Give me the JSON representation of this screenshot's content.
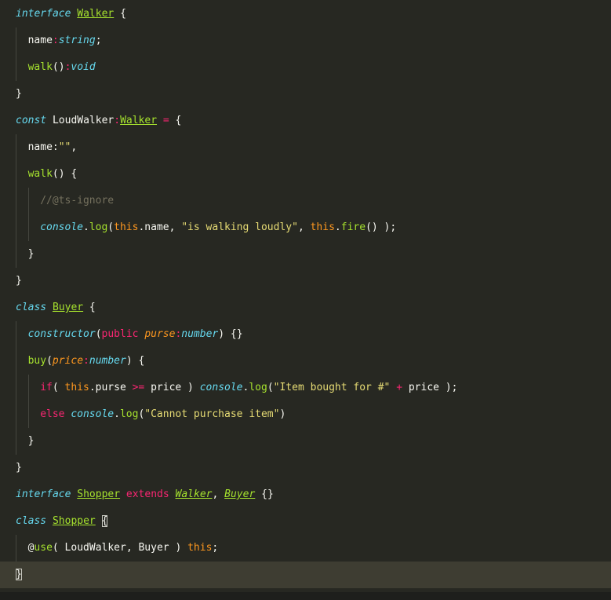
{
  "editor": {
    "language": "typescript",
    "theme": {
      "background": "#272822",
      "current_line": "#3e3d32"
    },
    "lines": [
      {
        "indent": 0,
        "tokens": [
          {
            "t": "interface",
            "c": "kw"
          },
          {
            "t": " ",
            "c": "pl"
          },
          {
            "t": "Walker",
            "c": "ty"
          },
          {
            "t": " {",
            "c": "pl"
          }
        ]
      },
      {
        "indent": 1,
        "tokens": [
          {
            "t": "name",
            "c": "pl"
          },
          {
            "t": ":",
            "c": "op"
          },
          {
            "t": "string",
            "c": "tp"
          },
          {
            "t": ";",
            "c": "pl"
          }
        ]
      },
      {
        "indent": 1,
        "tokens": [
          {
            "t": "walk",
            "c": "fn"
          },
          {
            "t": "()",
            "c": "pl"
          },
          {
            "t": ":",
            "c": "op"
          },
          {
            "t": "void",
            "c": "tp"
          }
        ]
      },
      {
        "indent": 0,
        "tokens": [
          {
            "t": "}",
            "c": "pl"
          }
        ]
      },
      {
        "indent": 0,
        "tokens": [
          {
            "t": "const",
            "c": "kw"
          },
          {
            "t": " LoudWalker",
            "c": "pl"
          },
          {
            "t": ":",
            "c": "op"
          },
          {
            "t": "Walker",
            "c": "ty"
          },
          {
            "t": " ",
            "c": "pl"
          },
          {
            "t": "=",
            "c": "op"
          },
          {
            "t": " {",
            "c": "pl"
          }
        ]
      },
      {
        "indent": 1,
        "tokens": [
          {
            "t": "name:",
            "c": "pl"
          },
          {
            "t": "\"\"",
            "c": "str"
          },
          {
            "t": ",",
            "c": "pl"
          }
        ]
      },
      {
        "indent": 1,
        "tokens": [
          {
            "t": "walk",
            "c": "fn"
          },
          {
            "t": "() {",
            "c": "pl"
          }
        ]
      },
      {
        "indent": 2,
        "tokens": [
          {
            "t": "//@ts-ignore",
            "c": "cm"
          }
        ]
      },
      {
        "indent": 2,
        "tokens": [
          {
            "t": "console",
            "c": "cn"
          },
          {
            "t": ".",
            "c": "pl"
          },
          {
            "t": "log",
            "c": "fn"
          },
          {
            "t": "(",
            "c": "pl"
          },
          {
            "t": "this",
            "c": "th"
          },
          {
            "t": ".name, ",
            "c": "pl"
          },
          {
            "t": "\"is walking loudly\"",
            "c": "str"
          },
          {
            "t": ", ",
            "c": "pl"
          },
          {
            "t": "this",
            "c": "th"
          },
          {
            "t": ".",
            "c": "pl"
          },
          {
            "t": "fire",
            "c": "fn"
          },
          {
            "t": "() );",
            "c": "pl"
          }
        ]
      },
      {
        "indent": 1,
        "tokens": [
          {
            "t": "}",
            "c": "pl"
          }
        ]
      },
      {
        "indent": 0,
        "tokens": [
          {
            "t": "}",
            "c": "pl"
          }
        ]
      },
      {
        "indent": 0,
        "tokens": [
          {
            "t": "class",
            "c": "kw"
          },
          {
            "t": " ",
            "c": "pl"
          },
          {
            "t": "Buyer",
            "c": "ty"
          },
          {
            "t": " {",
            "c": "pl"
          }
        ]
      },
      {
        "indent": 1,
        "tokens": [
          {
            "t": "constructor",
            "c": "kw"
          },
          {
            "t": "(",
            "c": "pl"
          },
          {
            "t": "public",
            "c": "kwp"
          },
          {
            "t": " ",
            "c": "pl"
          },
          {
            "t": "purse",
            "c": "par"
          },
          {
            "t": ":",
            "c": "op"
          },
          {
            "t": "number",
            "c": "tp"
          },
          {
            "t": ") {}",
            "c": "pl"
          }
        ]
      },
      {
        "indent": 1,
        "tokens": [
          {
            "t": "buy",
            "c": "fn"
          },
          {
            "t": "(",
            "c": "pl"
          },
          {
            "t": "price",
            "c": "par"
          },
          {
            "t": ":",
            "c": "op"
          },
          {
            "t": "number",
            "c": "tp"
          },
          {
            "t": ") {",
            "c": "pl"
          }
        ]
      },
      {
        "indent": 2,
        "tokens": [
          {
            "t": "if",
            "c": "kwp"
          },
          {
            "t": "( ",
            "c": "pl"
          },
          {
            "t": "this",
            "c": "th"
          },
          {
            "t": ".purse ",
            "c": "pl"
          },
          {
            "t": ">=",
            "c": "op"
          },
          {
            "t": " price ) ",
            "c": "pl"
          },
          {
            "t": "console",
            "c": "cn"
          },
          {
            "t": ".",
            "c": "pl"
          },
          {
            "t": "log",
            "c": "fn"
          },
          {
            "t": "(",
            "c": "pl"
          },
          {
            "t": "\"Item bought for #\"",
            "c": "str"
          },
          {
            "t": " ",
            "c": "pl"
          },
          {
            "t": "+",
            "c": "op"
          },
          {
            "t": " price );",
            "c": "pl"
          }
        ]
      },
      {
        "indent": 2,
        "tokens": [
          {
            "t": "else",
            "c": "kwp"
          },
          {
            "t": " ",
            "c": "pl"
          },
          {
            "t": "console",
            "c": "cn"
          },
          {
            "t": ".",
            "c": "pl"
          },
          {
            "t": "log",
            "c": "fn"
          },
          {
            "t": "(",
            "c": "pl"
          },
          {
            "t": "\"Cannot purchase item\"",
            "c": "str"
          },
          {
            "t": ")",
            "c": "pl"
          }
        ]
      },
      {
        "indent": 1,
        "tokens": [
          {
            "t": "}",
            "c": "pl"
          }
        ]
      },
      {
        "indent": 0,
        "tokens": [
          {
            "t": "}",
            "c": "pl"
          }
        ]
      },
      {
        "indent": 0,
        "tokens": [
          {
            "t": "interface",
            "c": "kw"
          },
          {
            "t": " ",
            "c": "pl"
          },
          {
            "t": "Shopper",
            "c": "ty"
          },
          {
            "t": " ",
            "c": "pl"
          },
          {
            "t": "extends",
            "c": "kwp"
          },
          {
            "t": " ",
            "c": "pl"
          },
          {
            "t": "Walker",
            "c": "tyi"
          },
          {
            "t": ", ",
            "c": "pl"
          },
          {
            "t": "Buyer",
            "c": "tyi"
          },
          {
            "t": " {}",
            "c": "pl"
          }
        ]
      },
      {
        "indent": 0,
        "tokens": [
          {
            "t": "class",
            "c": "kw"
          },
          {
            "t": " ",
            "c": "pl"
          },
          {
            "t": "Shopper",
            "c": "ty"
          },
          {
            "t": " ",
            "c": "pl"
          },
          {
            "t": "{",
            "c": "pl",
            "match": true
          }
        ]
      },
      {
        "indent": 1,
        "tokens": [
          {
            "t": "@",
            "c": "pl"
          },
          {
            "t": "use",
            "c": "fn"
          },
          {
            "t": "( LoudWalker, Buyer ) ",
            "c": "pl"
          },
          {
            "t": "this",
            "c": "th"
          },
          {
            "t": ";",
            "c": "pl"
          }
        ]
      },
      {
        "indent": 0,
        "current": true,
        "tokens": [
          {
            "t": "}",
            "c": "pl",
            "match": true
          }
        ]
      }
    ]
  }
}
